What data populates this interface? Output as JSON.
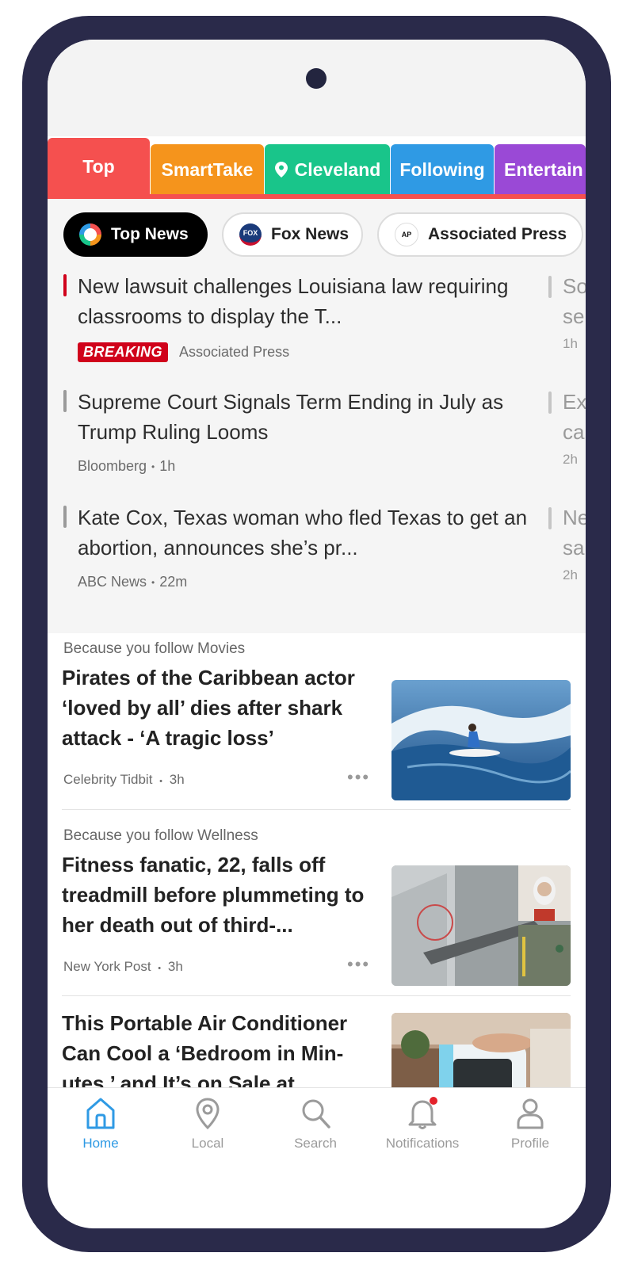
{
  "category_tabs": [
    {
      "label": "Top",
      "color": "#f5504f"
    },
    {
      "label": "SmartTake",
      "color": "#f5941c"
    },
    {
      "label": "Cleveland",
      "color": "#19c58a"
    },
    {
      "label": "Following",
      "color": "#2f9ae4"
    },
    {
      "label": "Entertain",
      "color": "#9a49d6"
    }
  ],
  "source_chips": [
    {
      "label": "Top News",
      "selected": true
    },
    {
      "label": "Fox News",
      "selected": false
    },
    {
      "label": "Associated Press",
      "selected": false
    }
  ],
  "top_stories": [
    {
      "title": "New lawsuit challenges Louisiana law requiring classrooms to display the T...",
      "badge": "BREAKING",
      "source": "Associated Press",
      "time": ""
    },
    {
      "title": "Supreme Court Signals Term Ending in July as Trump Ruling Looms",
      "badge": "",
      "source": "Bloomberg",
      "time": "1h"
    },
    {
      "title": "Kate Cox, Texas woman who fled Texas to get an abortion, announces she’s pr...",
      "badge": "",
      "source": "ABC News",
      "time": "22m"
    }
  ],
  "peek_stories": [
    {
      "line1": "So",
      "line2": "se",
      "time": "1h"
    },
    {
      "line1": "Ex",
      "line2": "ca",
      "time": "2h"
    },
    {
      "line1": "Ne",
      "line2": "sa",
      "time": "2h"
    }
  ],
  "articles": [
    {
      "reason": "Because you follow Movies",
      "headline": "Pirates of the Caribbean actor ‘loved by all’ dies after shark attack - ‘A tragic loss’",
      "source": "Celebrity Tidbit",
      "time": "3h",
      "thumb": "surfer"
    },
    {
      "reason": "Because you follow Wellness",
      "headline": "Fitness fanatic, 22, falls off treadmill before plummeting to her death out of third-...",
      "source": "New York Post",
      "time": "3h",
      "thumb": "treadmill-cctv"
    },
    {
      "reason": "",
      "headline": "This Portable Air Conditioner Can Cool a ‘Bedroom in Min-utes,’ and It’s on Sale at...",
      "source": "",
      "time": "",
      "thumb": "portable-ac"
    }
  ],
  "bottom_nav": [
    {
      "label": "Home",
      "icon": "home-icon",
      "active": true
    },
    {
      "label": "Local",
      "icon": "location-pin-icon",
      "active": false
    },
    {
      "label": "Search",
      "icon": "search-icon",
      "active": false
    },
    {
      "label": "Notifications",
      "icon": "bell-icon",
      "active": false,
      "has_dot": true
    },
    {
      "label": "Profile",
      "icon": "person-icon",
      "active": false
    }
  ],
  "more_glyph": "•••",
  "dot_sep": "•"
}
